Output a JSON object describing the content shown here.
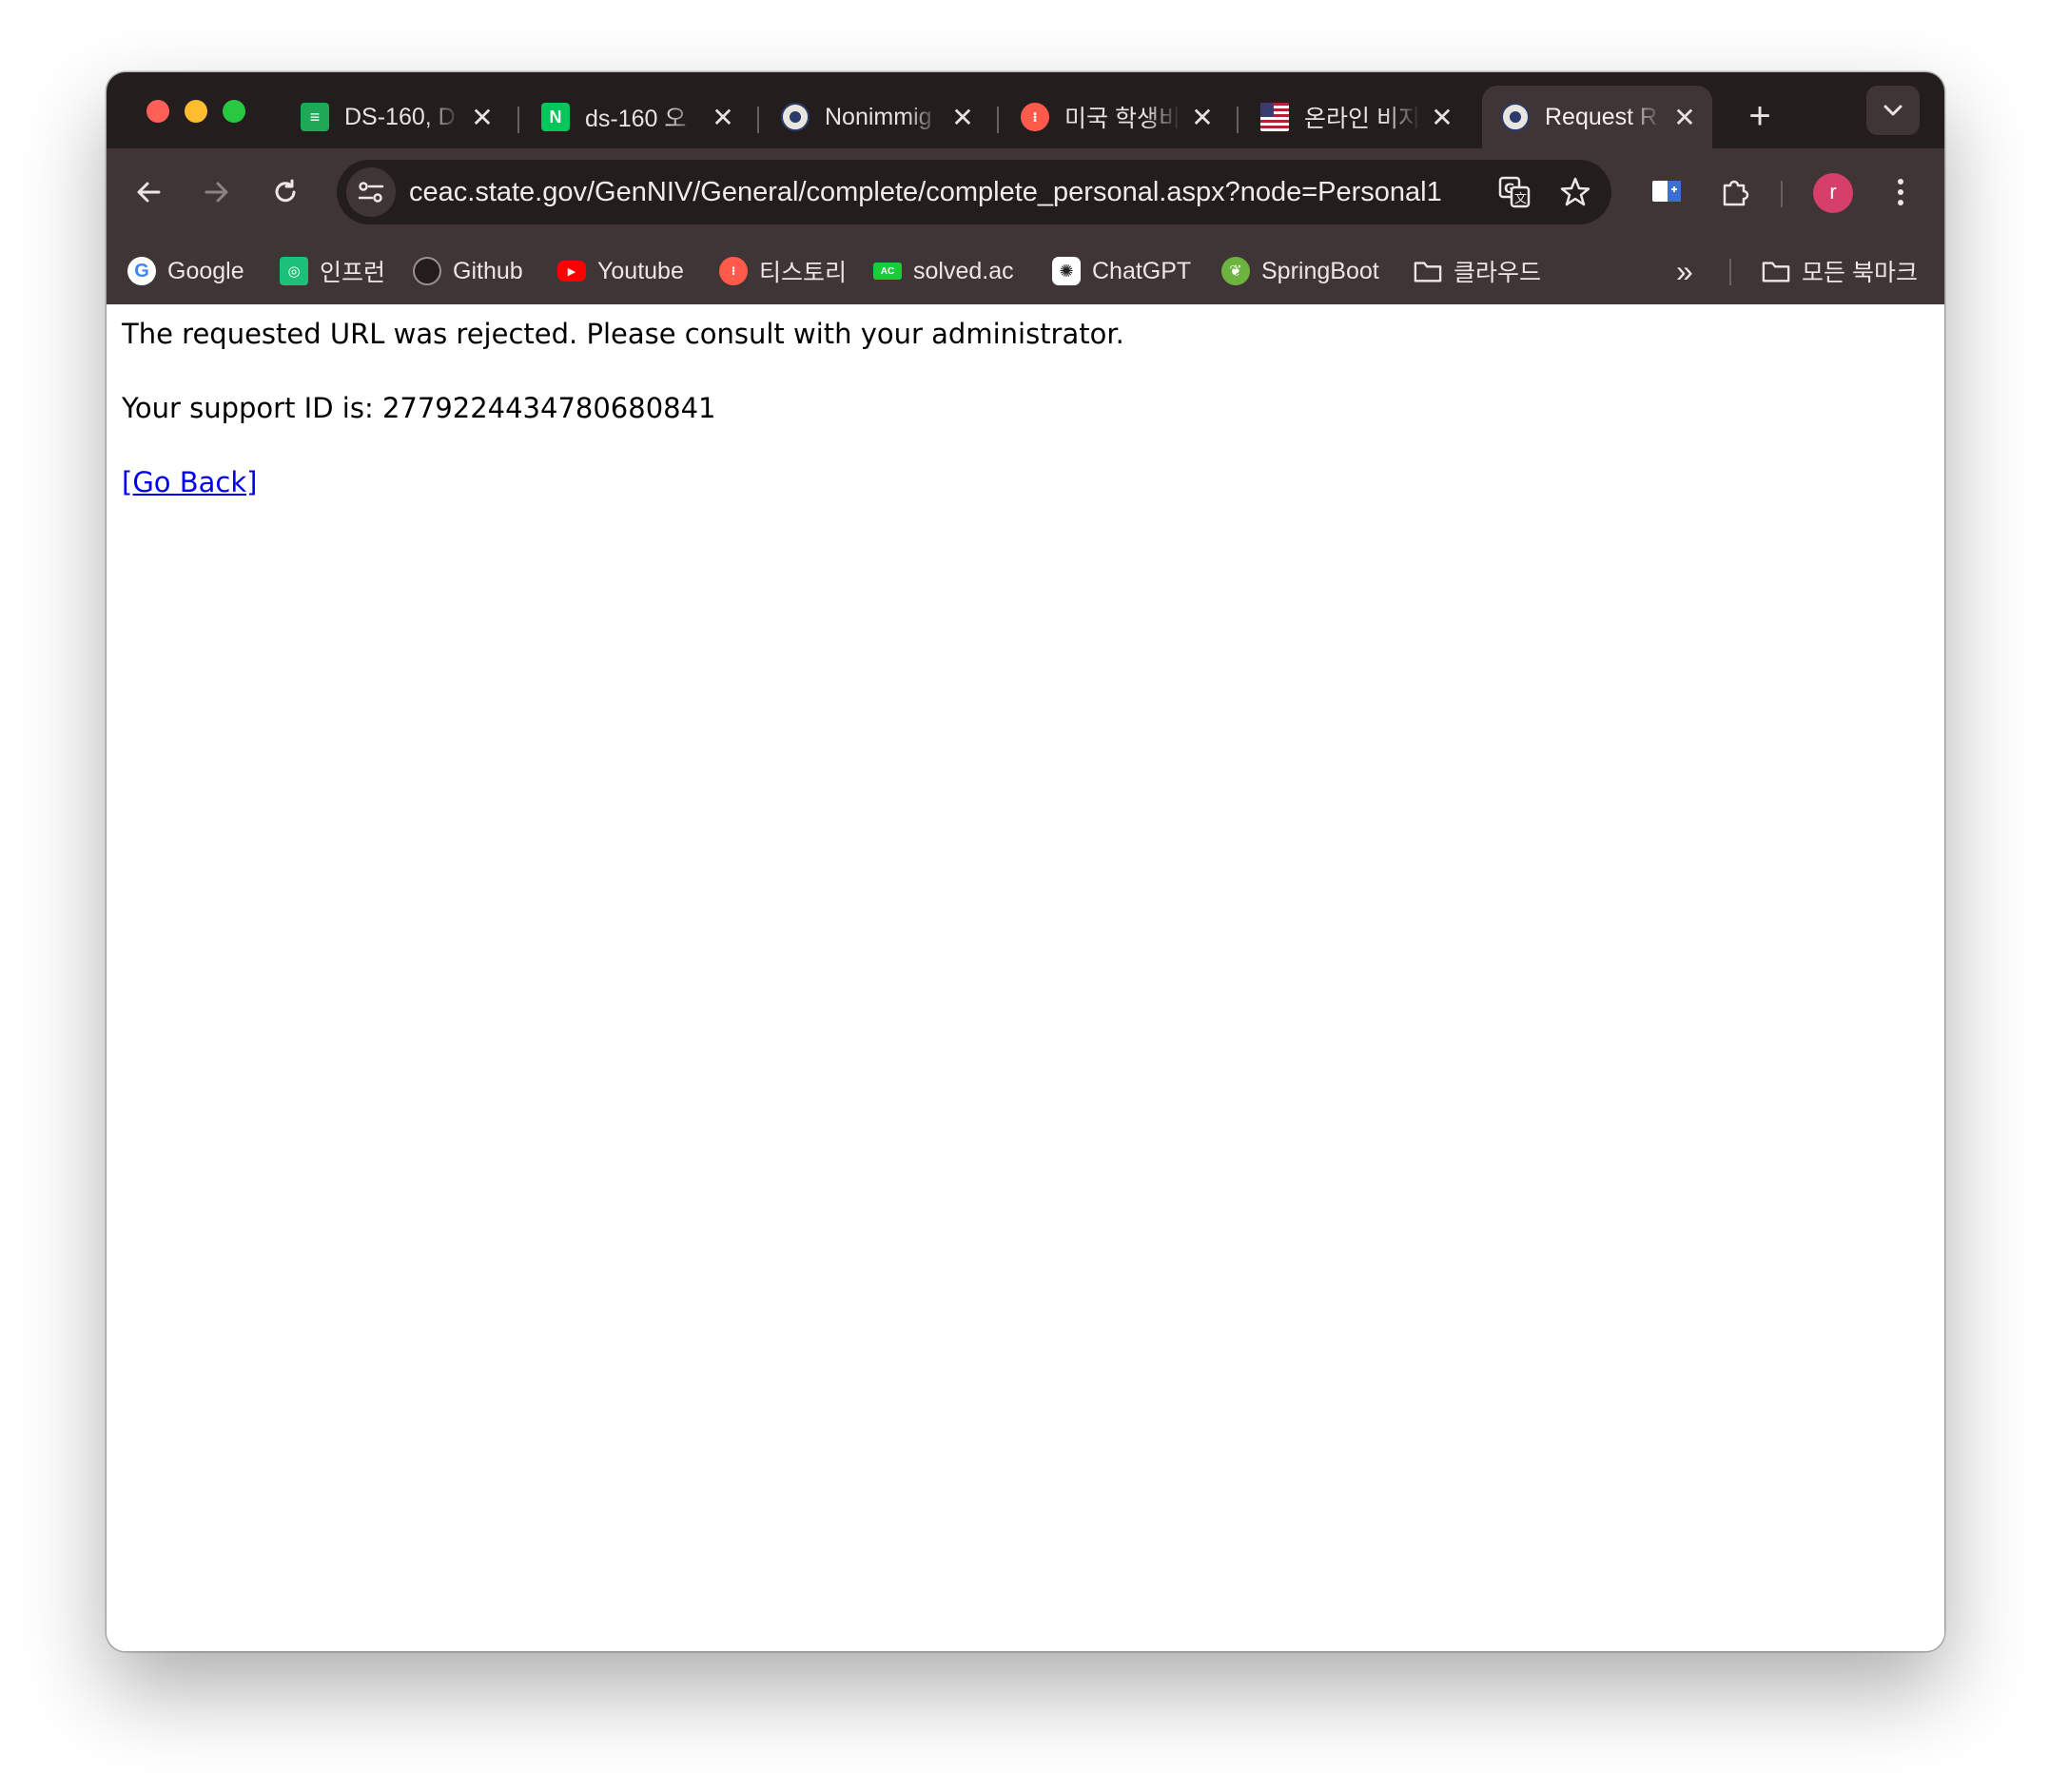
{
  "tabs": [
    {
      "title": "DS-160, D",
      "favicon": "doc-icon",
      "favicon_glyph": "≡",
      "favicon_color": "#1fa855",
      "active": false
    },
    {
      "title": "ds-160 오",
      "favicon": "naver-icon",
      "favicon_glyph": "N",
      "favicon_color": "#03c75a",
      "active": false
    },
    {
      "title": "Nonimmig",
      "favicon": "state-seal-icon",
      "favicon_glyph": "",
      "favicon_color": "#2a3a6a",
      "active": false
    },
    {
      "title": "미국 학생비",
      "favicon": "tistory-icon",
      "favicon_glyph": "⁝",
      "favicon_color": "#ff5a4a",
      "active": false
    },
    {
      "title": "온라인 비지",
      "favicon": "us-flag-icon",
      "favicon_glyph": "",
      "favicon_color": "#b22234",
      "active": false
    },
    {
      "title": "Request R",
      "favicon": "state-seal-icon",
      "favicon_glyph": "",
      "favicon_color": "#2a3a6a",
      "active": true
    }
  ],
  "tab_close_glyph": "✕",
  "new_tab_glyph": "+",
  "address_bar": {
    "url": "ceac.state.gov/GenNIV/General/complete/complete_personal.aspx?node=Personal1"
  },
  "profile": {
    "initial": "r",
    "color": "#d63f6a"
  },
  "bookmarks": [
    {
      "label": "Google",
      "icon": "google-icon",
      "glyph": "G"
    },
    {
      "label": "인프런",
      "icon": "inflearn-icon",
      "glyph": "◎"
    },
    {
      "label": "Github",
      "icon": "github-icon",
      "glyph": ""
    },
    {
      "label": "Youtube",
      "icon": "youtube-icon",
      "glyph": "▶"
    },
    {
      "label": "티스토리",
      "icon": "tistory-icon",
      "glyph": "⁝"
    },
    {
      "label": "solved.ac",
      "icon": "solved-ac-icon",
      "glyph": "AC"
    },
    {
      "label": "ChatGPT",
      "icon": "chatgpt-icon",
      "glyph": "✺"
    },
    {
      "label": "SpringBoot",
      "icon": "spring-icon",
      "glyph": "❦"
    },
    {
      "label": "클라우드",
      "icon": "folder-icon",
      "glyph": "🗀"
    }
  ],
  "bookmarks_overflow_glyph": "»",
  "all_bookmarks": {
    "label": "모든 북마크",
    "icon": "folder-icon"
  },
  "page": {
    "message": "The requested URL was rejected. Please consult with your administrator.",
    "support_id_text": "Your support ID is: 2779224434780680841",
    "go_back_link": "[Go Back]"
  },
  "colors": {
    "tabstrip_bg": "#241d1e",
    "toolbar_bg": "#3f3536",
    "link": "#0000ee"
  }
}
